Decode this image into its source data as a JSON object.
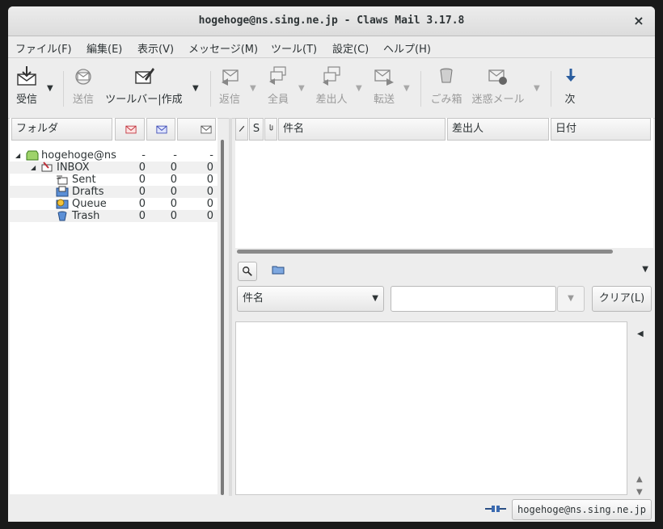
{
  "window": {
    "title": "hogehoge@ns.sing.ne.jp - Claws Mail 3.17.8",
    "close_glyph": "×"
  },
  "menu": [
    "ファイル(F)",
    "編集(E)",
    "表示(V)",
    "メッセージ(M)",
    "ツール(T)",
    "設定(C)",
    "ヘルプ(H)"
  ],
  "toolbar": {
    "receive": "受信",
    "send": "送信",
    "compose": "ツールバー|作成",
    "reply": "返信",
    "reply_all": "全員",
    "reply_sender": "差出人",
    "forward": "転送",
    "trash": "ごみ箱",
    "junk": "迷惑メール",
    "next": "次"
  },
  "folder_pane": {
    "header": "フォルダ",
    "folders": [
      {
        "name": "hogehoge@ns",
        "new": "-",
        "unread": "-",
        "total": "-",
        "icon": "mailbox-icon"
      },
      {
        "name": "INBOX",
        "new": "0",
        "unread": "0",
        "total": "0",
        "icon": "inbox-icon"
      },
      {
        "name": "Sent",
        "new": "0",
        "unread": "0",
        "total": "0",
        "icon": "sent-icon"
      },
      {
        "name": "Drafts",
        "new": "0",
        "unread": "0",
        "total": "0",
        "icon": "drafts-icon"
      },
      {
        "name": "Queue",
        "new": "0",
        "unread": "0",
        "total": "0",
        "icon": "queue-icon"
      },
      {
        "name": "Trash",
        "new": "0",
        "unread": "0",
        "total": "0",
        "icon": "trash-icon"
      }
    ]
  },
  "message_list": {
    "columns": {
      "mark": "",
      "status": "S",
      "attach": "",
      "subject": "件名",
      "from": "差出人",
      "date": "日付"
    }
  },
  "quick_search": {
    "type_selected": "件名",
    "value": "",
    "clear_label": "クリア(L)"
  },
  "statusbar": {
    "account": "hogehoge@ns.sing.ne.jp"
  }
}
